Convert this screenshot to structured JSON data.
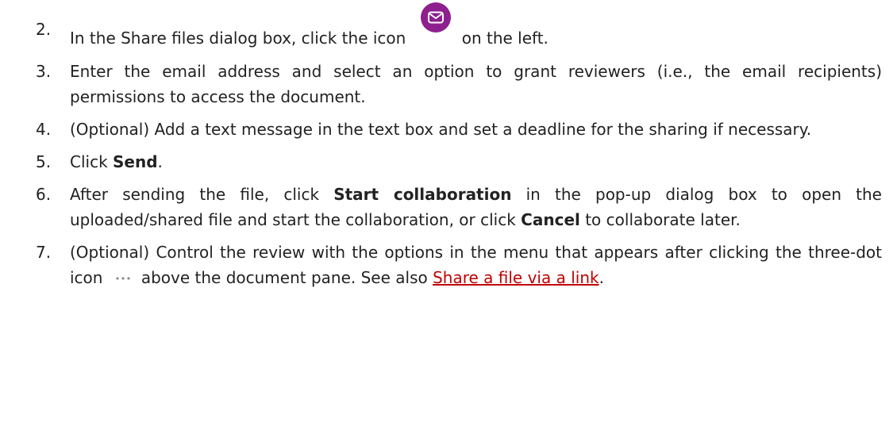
{
  "steps": [
    {
      "num": "2.",
      "text_before_icon": "In the Share files dialog box, click the icon",
      "icon": "mail-icon",
      "text_after_icon": "on the left."
    },
    {
      "num": "3.",
      "text": "Enter the email address and select an option to grant reviewers (i.e., the email recipients) permissions to access the document."
    },
    {
      "num": "4.",
      "text": "(Optional) Add a text message in the text box and set a deadline for the sharing if necessary."
    },
    {
      "num": "5.",
      "text_before": "Click ",
      "bold": "Send",
      "text_after": "."
    },
    {
      "num": "6.",
      "text_1": "After sending the file, click ",
      "bold_1": "Start collaboration",
      "text_2": " in the pop-up dialog box to open the uploaded/shared file and start the collaboration, or click ",
      "bold_2": "Cancel",
      "text_3": " to collaborate later."
    },
    {
      "num": "7.",
      "text_before_icon": "(Optional) Control the review with the options in the menu that appears after clicking the three-dot icon",
      "icon": "three-dot-icon",
      "text_after_icon": "above the document pane. See also ",
      "link_text": "Share a file via a link",
      "text_end": "."
    }
  ],
  "colors": {
    "text": "#222222",
    "mail_icon_bg": "#8e1f8e",
    "link": "#c00000",
    "dots": "#8a8a8a"
  }
}
